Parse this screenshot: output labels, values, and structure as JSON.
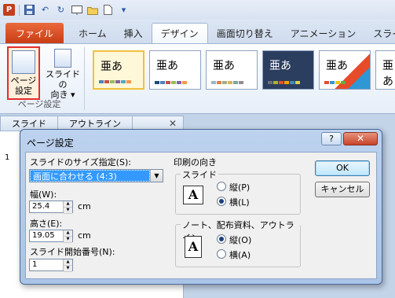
{
  "qat": {
    "app_icon": "P"
  },
  "tabs": [
    "ファイル",
    "ホーム",
    "挿入",
    "デザイン",
    "画面切り替え",
    "アニメーション",
    "スライド ショー"
  ],
  "ribbon": {
    "page_setup": {
      "line1": "ページ",
      "line2": "設定"
    },
    "orientation": {
      "line1": "スライドの",
      "line2": "向き ▾"
    },
    "group_label": "ページ設定",
    "theme_glyph": "亜あ"
  },
  "pane": {
    "tab_slides": "スライド",
    "tab_outline": "アウトライン",
    "close": "✕",
    "thumb_number": "1"
  },
  "dialog": {
    "title": "ページ設定",
    "help": "?",
    "close": "✕",
    "size_label": "スライドのサイズ指定(S):",
    "size_value": "画面に合わせる (4:3)",
    "width_label": "幅(W):",
    "width_value": "25.4",
    "width_unit": "cm",
    "height_label": "高さ(E):",
    "height_value": "19.05",
    "height_unit": "cm",
    "start_label": "スライド開始番号(N):",
    "start_value": "1",
    "orientation_title": "印刷の向き",
    "slides_group": "スライド",
    "notes_group": "ノート、配布資料、アウトライン",
    "orient_glyph": "A",
    "portrait": "縦(P)",
    "landscape": "横(L)",
    "notes_portrait": "縦(O)",
    "notes_landscape": "横(A)",
    "ok": "OK",
    "cancel": "キャンセル"
  },
  "colors": {
    "accent": "#c43e1c",
    "selection": "#3399ff",
    "highlight": "#e52d2d"
  }
}
